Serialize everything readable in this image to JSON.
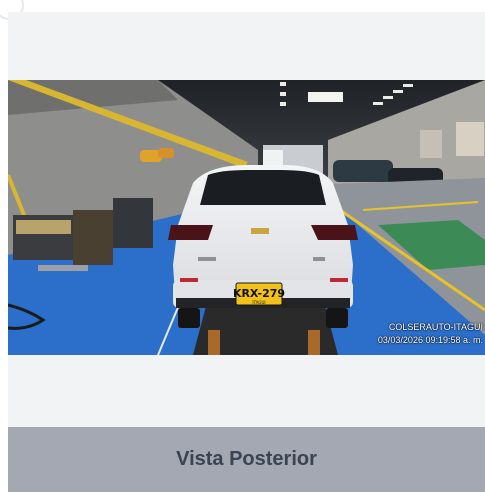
{
  "photo": {
    "plate_number": "KRX-279",
    "plate_subtext": "ITAGUI",
    "watermark_location": "COLSERAUTO-ITAGUI",
    "watermark_timestamp": "03/03/2026 09:19:58 a. m."
  },
  "caption": {
    "label": "Vista Posterior"
  },
  "colors": {
    "card_background": "#f1f3f5",
    "caption_background": "#a3a8b2",
    "caption_text": "#3b4452",
    "floor_blue": "#2b6fcb",
    "plate_yellow": "#f2c21b"
  }
}
